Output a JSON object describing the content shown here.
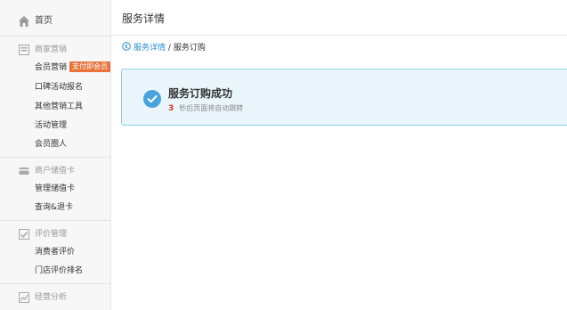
{
  "sidebar": {
    "home_label": "首页",
    "sections": [
      {
        "label": "商家营销",
        "icon": "store-icon",
        "items": [
          {
            "label": "会员营销",
            "badge": "支付即会员"
          },
          {
            "label": "口碑活动报名"
          },
          {
            "label": "其他营销工具"
          },
          {
            "label": "活动管理"
          },
          {
            "label": "会员圈人"
          }
        ]
      },
      {
        "label": "商户储值卡",
        "icon": "card-icon",
        "items": [
          {
            "label": "管理储值卡"
          },
          {
            "label": "查询&退卡"
          }
        ]
      },
      {
        "label": "评价管理",
        "icon": "review-icon",
        "items": [
          {
            "label": "消费者评价"
          },
          {
            "label": "门店评价排名"
          }
        ]
      },
      {
        "label": "经营分析",
        "icon": "chart-icon",
        "items": []
      }
    ]
  },
  "main": {
    "page_title": "服务详情",
    "breadcrumb": {
      "back_link": "服务详情",
      "separator": "/",
      "current": "服务订购"
    },
    "notice": {
      "title": "服务订购成功",
      "countdown": "3",
      "countdown_text": "秒后页面将自动跳转"
    }
  },
  "colors": {
    "badge": "#e8743b",
    "link": "#2e8fd6",
    "success_icon": "#4aa3df",
    "panel_bg": "#eaf6fb",
    "panel_border": "#8fd0e6",
    "countdown": "#d9302b"
  }
}
